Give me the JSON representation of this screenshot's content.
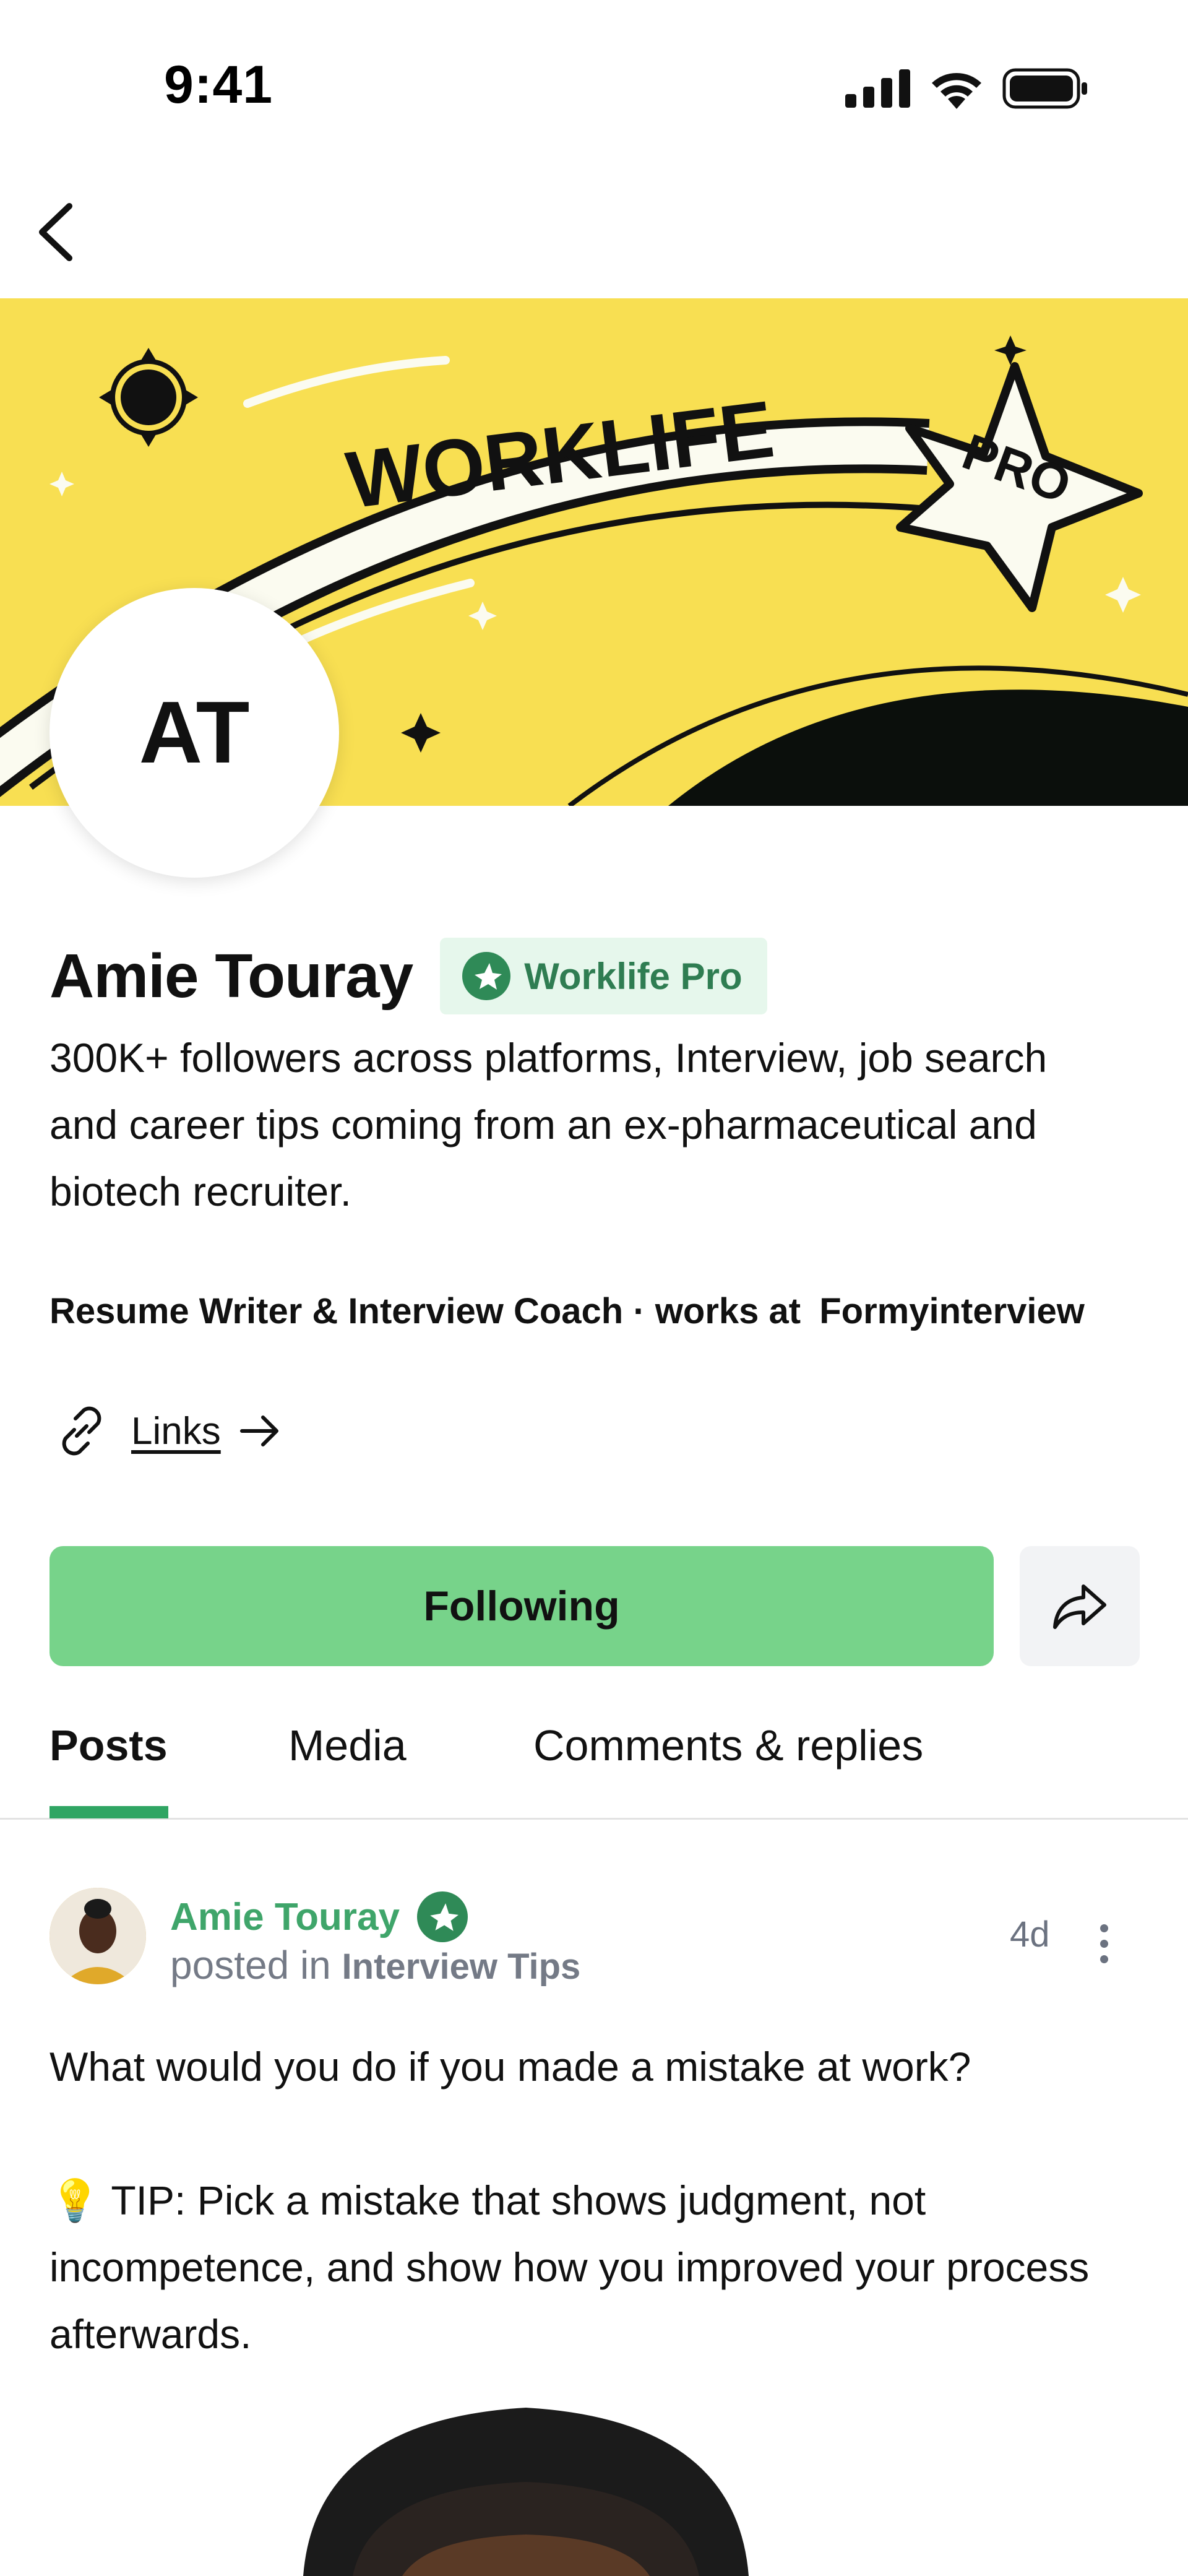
{
  "status_bar": {
    "time": "9:41",
    "icons": [
      "signal-icon",
      "wifi-icon",
      "battery-icon"
    ]
  },
  "header": {
    "back_icon": "chevron-left-icon"
  },
  "banner": {
    "wordmark": "WORKLIFE",
    "star_text": "PRO",
    "colors": {
      "background": "#f8df52",
      "ink": "#111111"
    }
  },
  "profile": {
    "initials": "AT",
    "name": "Amie Touray",
    "badge_label": "Worklife Pro",
    "bio": "300K+ followers across platforms, Interview, job search and career tips coming from an ex-pharmaceutical and biotech recruiter.",
    "role": "Resume Writer & Interview Coach",
    "works_at_label": "works at",
    "company": "Formyinterview",
    "links_label": "Links"
  },
  "actions": {
    "follow_label": "Following",
    "share_icon": "share-icon",
    "colors": {
      "follow": "#77d38a",
      "share_bg": "#f2f3f5"
    }
  },
  "tabs": [
    {
      "label": "Posts",
      "active": true
    },
    {
      "label": "Media",
      "active": false
    },
    {
      "label": "Comments & replies",
      "active": false
    }
  ],
  "post": {
    "author": "Amie Touray",
    "posted_in_label": "posted in",
    "community": "Interview Tips",
    "time": "4d",
    "question": "What would you do if you made a mistake at work?",
    "tip": "💡 TIP: Pick a mistake that shows judgment, not incompetence, and show how you improved your process afterwards.",
    "colors": {
      "author": "#3fa56a",
      "accent": "#2fa563"
    }
  }
}
